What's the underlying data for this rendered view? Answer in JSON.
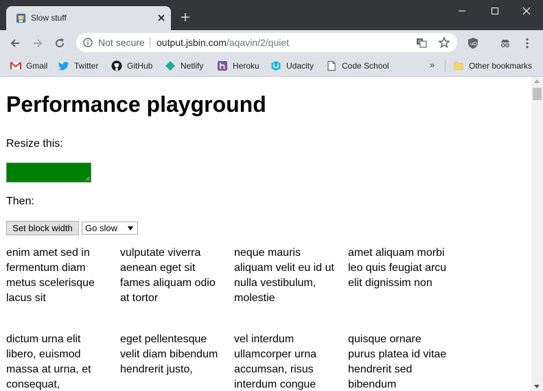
{
  "browser": {
    "tab_title": "Slow stuff",
    "url_security": "Not secure",
    "url_host": "output.jsbin.com",
    "url_path": "/aqavin/2/quiet",
    "accent": "#008000"
  },
  "bookmarks": {
    "items": [
      {
        "label": "Gmail",
        "icon": "gmail-icon"
      },
      {
        "label": "Twitter",
        "icon": "twitter-icon"
      },
      {
        "label": "GitHub",
        "icon": "github-icon"
      },
      {
        "label": "Netlify",
        "icon": "netlify-icon"
      },
      {
        "label": "Heroku",
        "icon": "heroku-icon"
      },
      {
        "label": "Udacity",
        "icon": "udacity-icon"
      },
      {
        "label": "Code School",
        "icon": "page-icon"
      }
    ],
    "more": "»",
    "other": "Other bookmarks"
  },
  "page": {
    "heading": "Performance playground",
    "resize_label": "Resize this:",
    "then_label": "Then:",
    "button_label": "Set block width",
    "select_value": "Go slow",
    "paragraphs": [
      "enim amet sed in fermentum diam metus scelerisque lacus sit",
      "vulputate viverra aenean eget sit fames aliquam odio at tortor",
      "neque mauris aliquam velit eu id ut nulla vestibulum, molestie",
      "amet aliquam morbi leo quis feugiat arcu elit dignissim non",
      "dictum urna elit libero, euismod massa at urna, et consequat,",
      "eget pellentesque velit diam bibendum hendrerit justo,",
      "vel interdum ullamcorper urna accumsan, risus interdum congue",
      "quisque ornare purus platea id vitae hendrerit sed bibendum"
    ]
  }
}
